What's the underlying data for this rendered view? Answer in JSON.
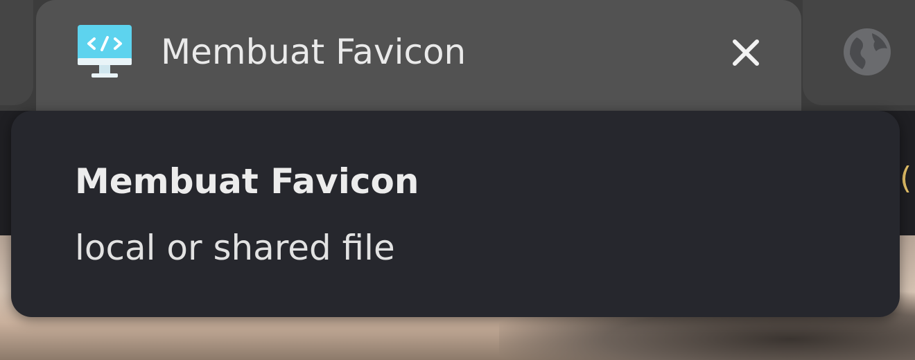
{
  "tab": {
    "title": "Membuat Favicon",
    "favicon_icon": "monitor-code-icon",
    "close_icon": "close-icon"
  },
  "next_tab": {
    "icon": "globe-icon"
  },
  "tooltip": {
    "title": "Membuat Favicon",
    "subtitle": "local or shared file"
  },
  "colors": {
    "tooltip_bg": "#26272d",
    "active_tab_bg": "#525252",
    "favicon_accent": "#4fc3e6"
  }
}
